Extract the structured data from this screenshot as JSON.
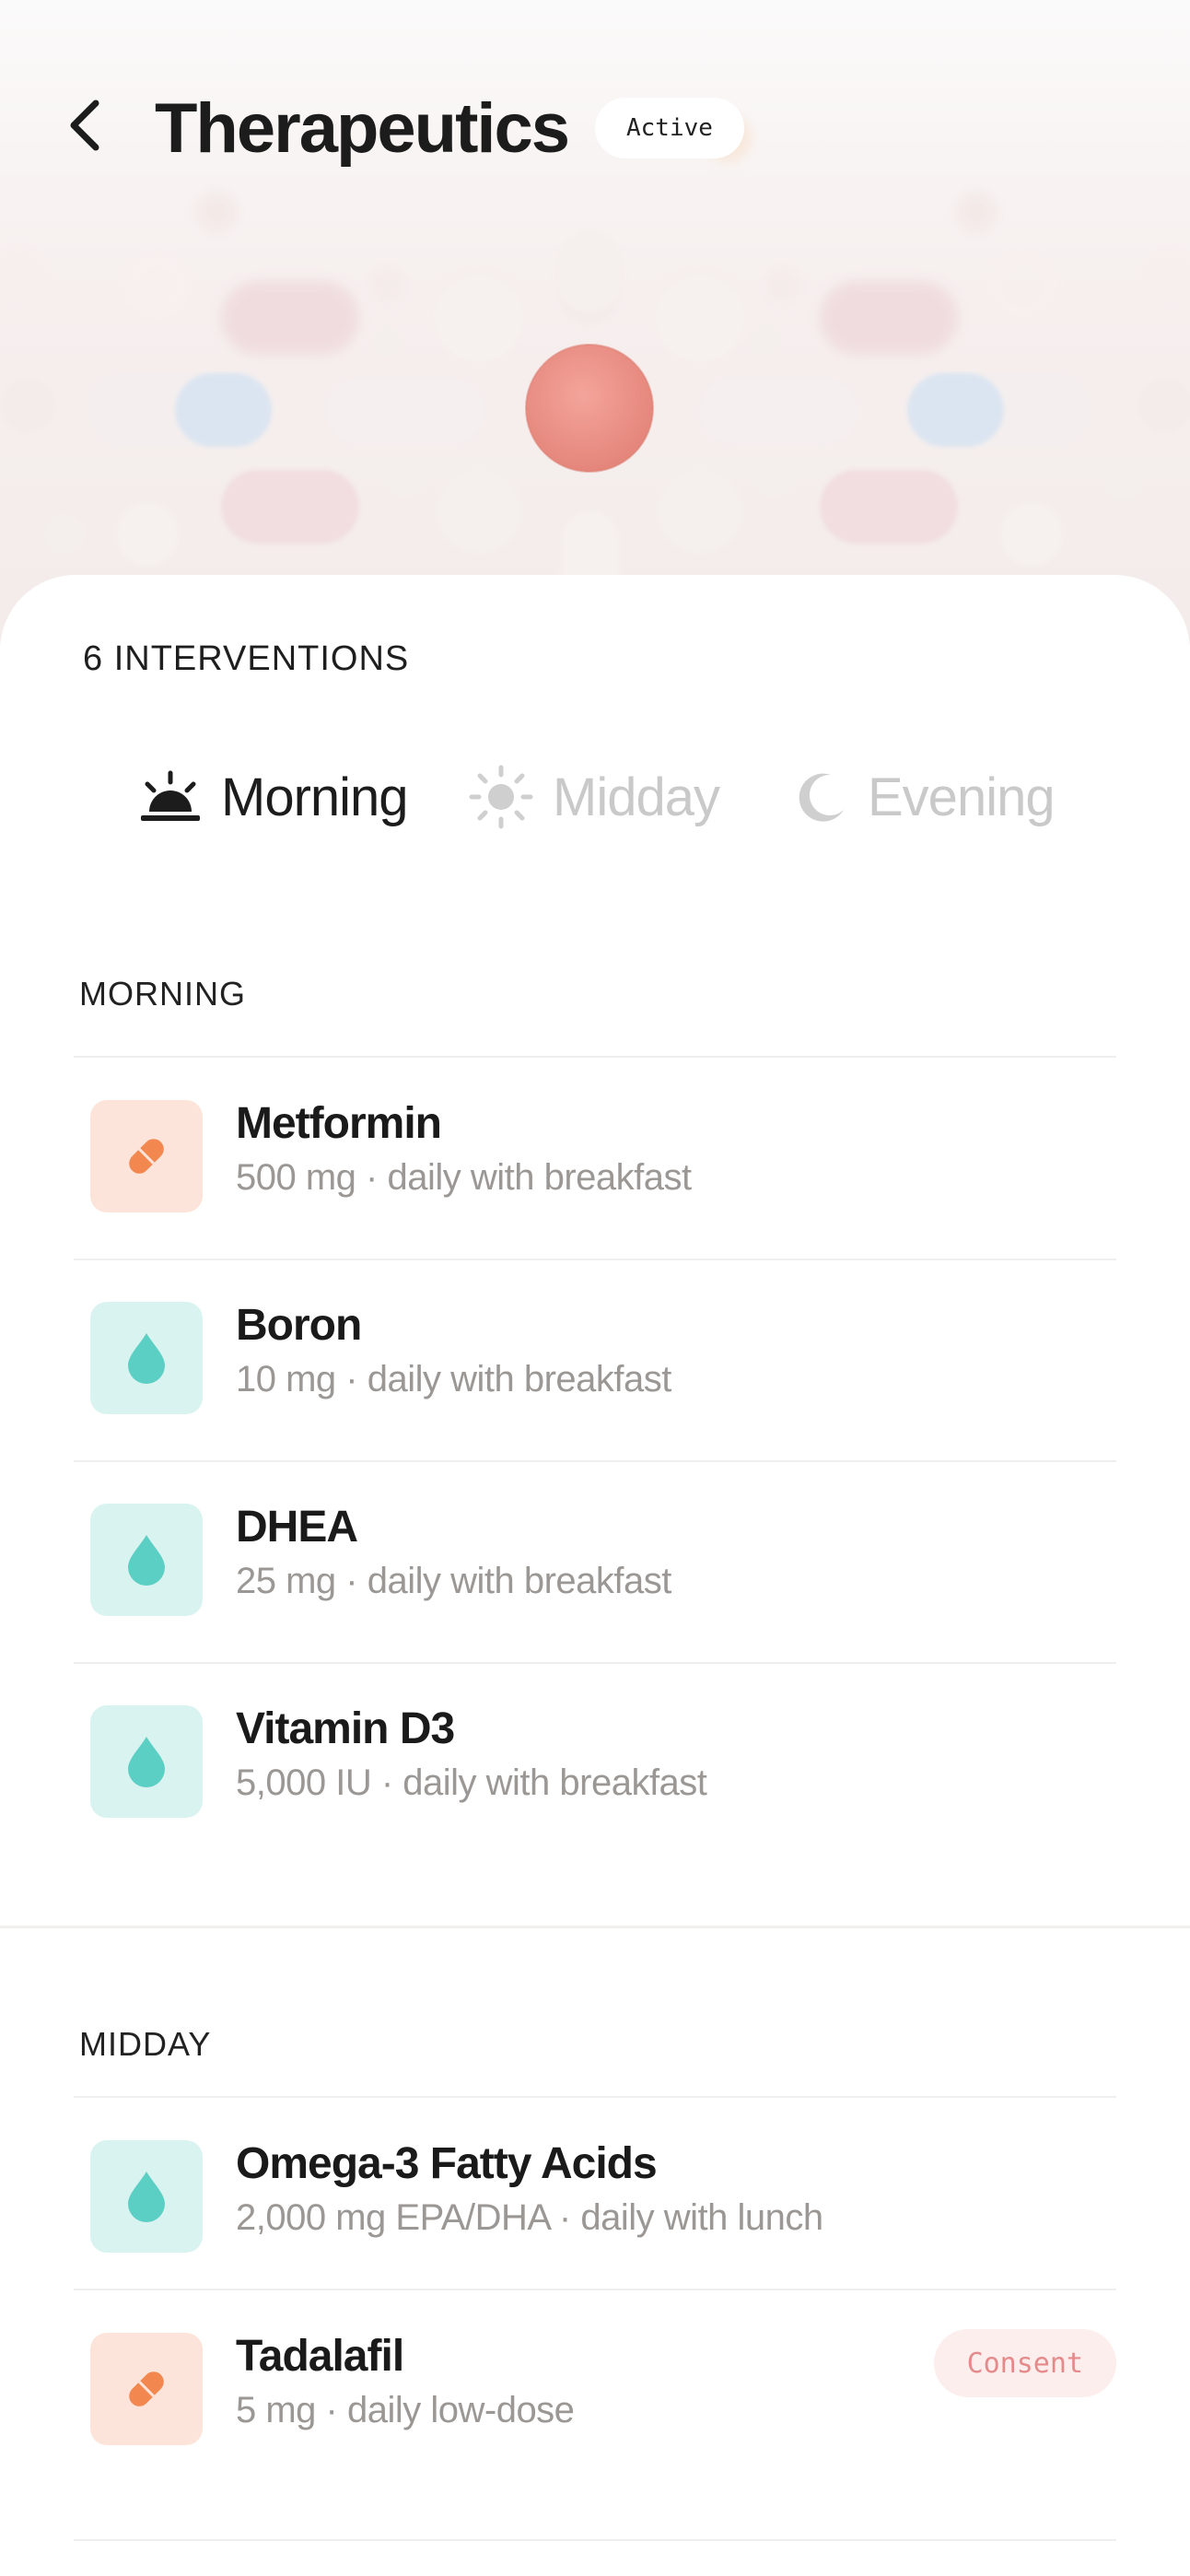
{
  "header": {
    "title": "Therapeutics",
    "status_badge": "Active",
    "back_icon": "chevron-left-icon"
  },
  "summary": {
    "count_label": "6 INTERVENTIONS"
  },
  "tabs": [
    {
      "label": "Morning",
      "icon": "sunrise-icon",
      "active": true
    },
    {
      "label": "Midday",
      "icon": "sun-icon",
      "active": false
    },
    {
      "label": "Evening",
      "icon": "moon-icon",
      "active": false
    }
  ],
  "sections": [
    {
      "title": "MORNING",
      "items": [
        {
          "name": "Metformin",
          "detail": "500 mg · daily with breakfast",
          "icon": "pill-icon"
        },
        {
          "name": "Boron",
          "detail": "10 mg · daily with breakfast",
          "icon": "drop-icon"
        },
        {
          "name": "DHEA",
          "detail": "25 mg · daily with breakfast",
          "icon": "drop-icon"
        },
        {
          "name": "Vitamin D3",
          "detail": "5,000 IU · daily with breakfast",
          "icon": "drop-icon"
        }
      ]
    },
    {
      "title": "MIDDAY",
      "items": [
        {
          "name": "Omega-3 Fatty Acids",
          "detail": "2,000 mg EPA/DHA · daily with lunch",
          "icon": "drop-icon"
        },
        {
          "name": "Tadalafil",
          "detail": "5 mg · daily low-dose",
          "icon": "pill-icon",
          "badge": "Consent"
        }
      ]
    }
  ],
  "colors": {
    "pill_tile": "#fde4da",
    "pill_icon": "#f2874f",
    "drop_tile": "#d9f3f1",
    "drop_icon": "#5ccfc4",
    "consent_bg": "#fdeeee",
    "consent_text": "#e58a8a",
    "inactive_text": "#c9c9c9"
  }
}
